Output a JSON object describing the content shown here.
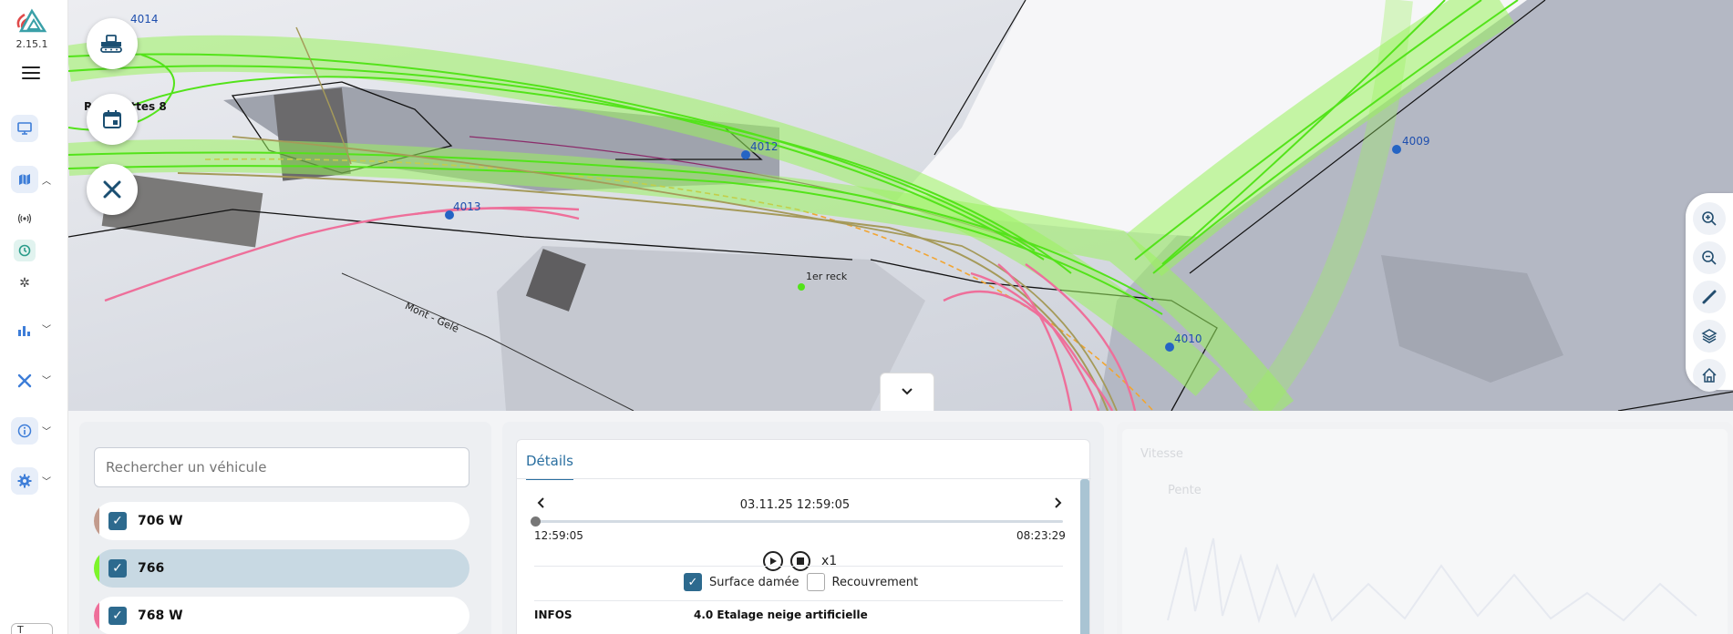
{
  "app": {
    "version": "2.15.1"
  },
  "colors": {
    "accent": "#2d6a8e",
    "track_green": "#7df52a",
    "track_pink": "#ee6f9a",
    "track_olive": "#a59a5a"
  },
  "rail": {
    "items": [
      {
        "icon": "monitor-icon"
      },
      {
        "icon": "map-icon",
        "expanded": true
      },
      {
        "icon": "broadcast-icon"
      },
      {
        "icon": "history-icon",
        "active": true
      },
      {
        "icon": "snowflake-icon"
      },
      {
        "icon": "bar-chart-icon"
      },
      {
        "icon": "tools-icon"
      },
      {
        "icon": "info-icon"
      },
      {
        "icon": "settings-icon"
      }
    ],
    "bottom_select": "T"
  },
  "map": {
    "labels": [
      {
        "text": "4014"
      },
      {
        "text": "4012"
      },
      {
        "text": "4009"
      },
      {
        "text": "4013"
      },
      {
        "text": "4010"
      },
      {
        "text": "1er reck"
      },
      {
        "text": "Mont - Gelé"
      },
      {
        "text": "R",
        "suffix": "ettes 8"
      }
    ],
    "fab_icons": [
      "snowcat-icon",
      "calendar-icon",
      "tools-icon"
    ],
    "zoom_controls": [
      "zoom-in-icon",
      "zoom-out-icon",
      "ruler-icon",
      "layers-icon",
      "home-icon"
    ],
    "collapse_icon": "chevron-down-icon"
  },
  "vehicles": {
    "search_placeholder": "Rechercher un véhicule",
    "items": [
      {
        "label": "706 W",
        "color": "#c29b8d",
        "checked": true,
        "selected": false
      },
      {
        "label": "766",
        "color": "#7df52a",
        "checked": true,
        "selected": true
      },
      {
        "label": "768 W",
        "color": "#ee6f9a",
        "checked": true,
        "selected": false
      }
    ]
  },
  "details": {
    "tab_label": "Détails",
    "date": "03.11.25 12:59:05",
    "time_start": "12:59:05",
    "time_end": "08:23:29",
    "progress": 0,
    "speed": "x1",
    "surface_label": "Surface damée",
    "surface_checked": true,
    "overlap_label": "Recouvrement",
    "overlap_checked": false,
    "infos_key": "INFOS",
    "infos_value": "4.0 Etalage neige artificielle"
  },
  "right_panel": {
    "ghost_title": "Vitesse",
    "ghost_legend": "Pente"
  }
}
